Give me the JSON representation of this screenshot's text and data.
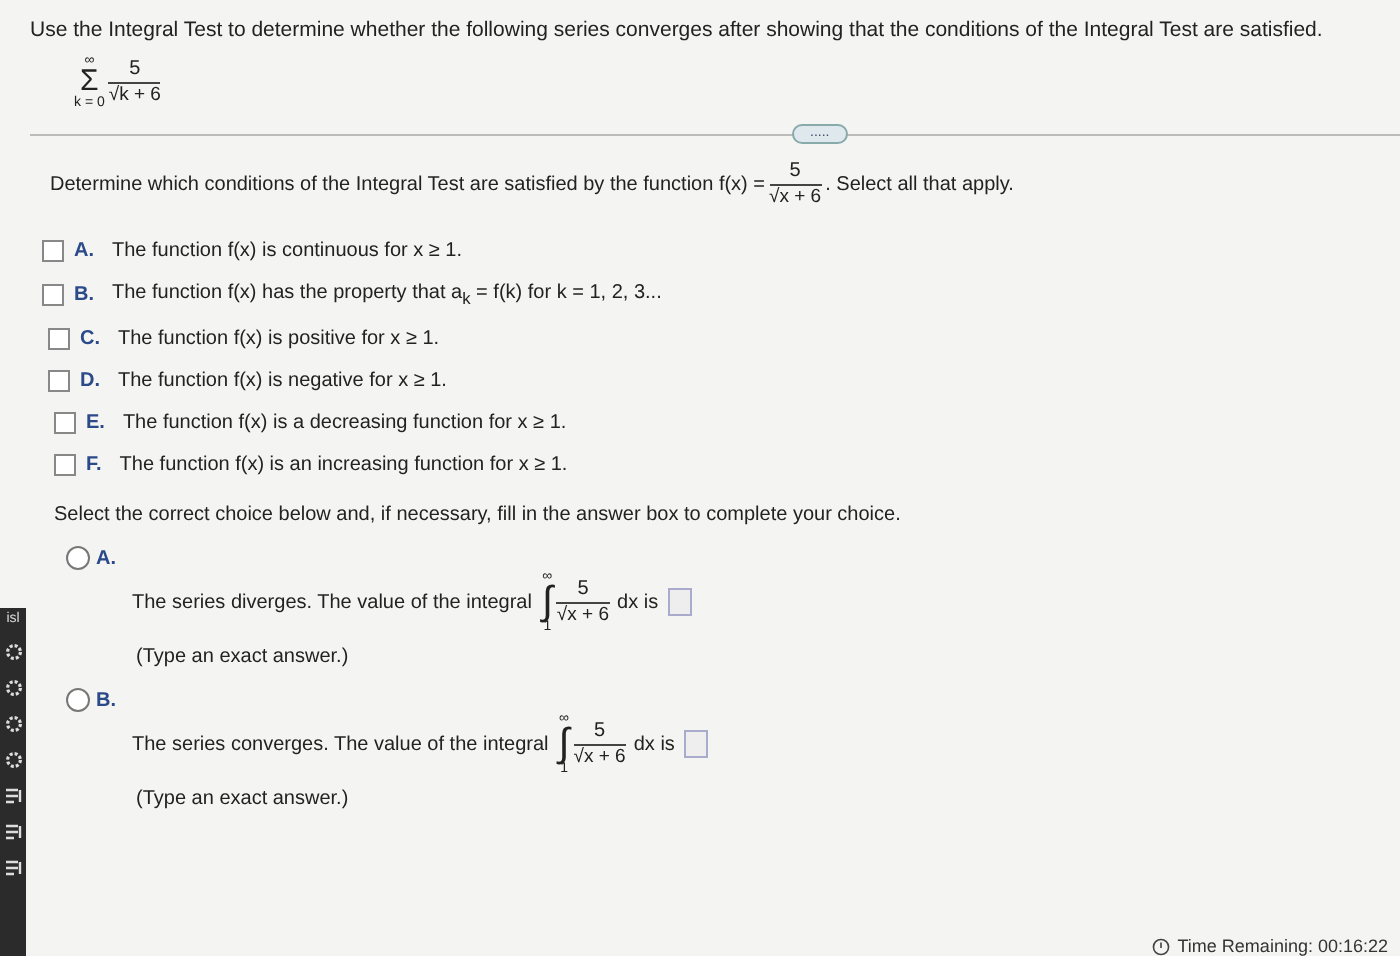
{
  "instruction": "Use the Integral Test to determine whether the following series converges after showing that the conditions of the Integral Test are satisfied.",
  "series": {
    "sigma": "Σ",
    "upper": "∞",
    "lower": "k = 0",
    "numerator": "5",
    "radical": "√",
    "radicand": "k + 6"
  },
  "expand_handle": ".....",
  "prompt": {
    "before": "Determine which conditions of the Integral Test are satisfied by the function f(x) =",
    "numerator": "5",
    "radical": "√",
    "radicand": "x + 6",
    "after": ". Select all that apply."
  },
  "conditions": [
    {
      "letter": "A.",
      "text": "The function f(x) is continuous for x ≥ 1.",
      "checked": false
    },
    {
      "letter": "B.",
      "text": "The function f(x) has the property that a$_{k}$ = f(k) for k = 1, 2, 3...",
      "checked": false
    },
    {
      "letter": "C.",
      "text": "The function f(x) is positive for x ≥ 1.",
      "checked": false
    },
    {
      "letter": "D.",
      "text": "The function f(x) is negative for x ≥ 1.",
      "checked": false
    },
    {
      "letter": "E.",
      "text": "The function f(x) is a decreasing function for x ≥ 1.",
      "checked": false
    },
    {
      "letter": "F.",
      "text": "The function f(x) is an increasing function for x ≥ 1.",
      "checked": false
    }
  ],
  "choice_prompt": "Select the correct choice below and, if necessary, fill in the answer box to complete your choice.",
  "choices": [
    {
      "letter": "A.",
      "selected": false,
      "statement": "The series diverges. The value of the integral",
      "integral": "∫",
      "upper": "∞",
      "lower": "1",
      "numerator": "5",
      "radical": "√",
      "radicand": "x + 6",
      "tail": "dx is",
      "hint": "(Type an exact answer.)"
    },
    {
      "letter": "B.",
      "selected": false,
      "statement": "The series converges. The value of the integral",
      "integral": "∫",
      "upper": "∞",
      "lower": "1",
      "numerator": "5",
      "radical": "√",
      "radicand": "x + 6",
      "tail": "dx is",
      "hint": "(Type an exact answer.)"
    }
  ],
  "side_panel": {
    "label": "isl"
  },
  "timer": "Time Remaining: 00:16:22"
}
